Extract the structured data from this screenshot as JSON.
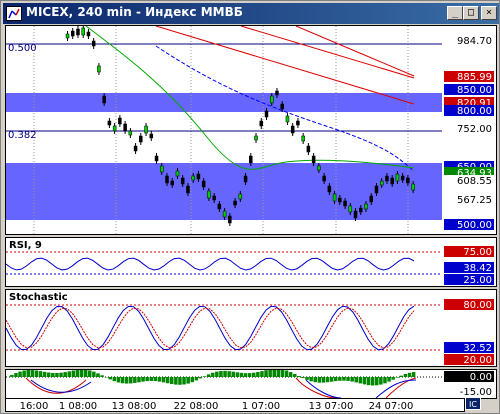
{
  "window": {
    "title": "MICEX, 240 min - Индекс ММВБ",
    "min_label": "_",
    "max_label": "□",
    "close_label": "×"
  },
  "main_chart": {
    "fib_levels": [
      "0.500",
      "0.382"
    ],
    "price_labels": [
      {
        "text": "984.70",
        "color": "#000000",
        "bg": "#ffffff"
      },
      {
        "text": "885.99",
        "color": "#ffffff",
        "bg": "#cc0000"
      },
      {
        "text": "850.00",
        "color": "#ffffff",
        "bg": "#0000cc"
      },
      {
        "text": "820.91",
        "color": "#ffffff",
        "bg": "#cc0000"
      },
      {
        "text": "800.00",
        "color": "#ffffff",
        "bg": "#0000cc"
      },
      {
        "text": "752.00",
        "color": "#000000",
        "bg": "#ffffff"
      },
      {
        "text": "650.00",
        "color": "#ffffff",
        "bg": "#0000cc"
      },
      {
        "text": "634.93",
        "color": "#ffffff",
        "bg": "#008800"
      },
      {
        "text": "608.55",
        "color": "#000000",
        "bg": "#ffffff"
      },
      {
        "text": "567.25",
        "color": "#000000",
        "bg": "#ffffff"
      },
      {
        "text": "500.00",
        "color": "#ffffff",
        "bg": "#0000cc"
      }
    ]
  },
  "rsi": {
    "label": "RSI, 9",
    "levels": [
      {
        "text": "75.00",
        "color": "#ffffff",
        "bg": "#cc0000"
      },
      {
        "text": "38.42",
        "color": "#ffffff",
        "bg": "#0000cc"
      },
      {
        "text": "25.00",
        "color": "#ffffff",
        "bg": "#0000cc"
      }
    ]
  },
  "stochastic": {
    "label": "Stochastic",
    "levels": [
      {
        "text": "80.00",
        "color": "#ffffff",
        "bg": "#cc0000"
      },
      {
        "text": "32.52",
        "color": "#ffffff",
        "bg": "#0000cc"
      },
      {
        "text": "20.00",
        "color": "#ffffff",
        "bg": "#cc0000"
      }
    ]
  },
  "macd": {
    "levels": [
      {
        "text": "0.00",
        "color": "#ffffff",
        "bg": "#000000"
      },
      {
        "text": "-15.00",
        "color": "#000000",
        "bg": "#ffffff"
      }
    ]
  },
  "time_axis": [
    "16:00",
    "1 08:00",
    "13 08:00",
    "22 08:00",
    "1 07:00",
    "13 07:00",
    "24 07:00"
  ],
  "corner_button": "IC"
}
